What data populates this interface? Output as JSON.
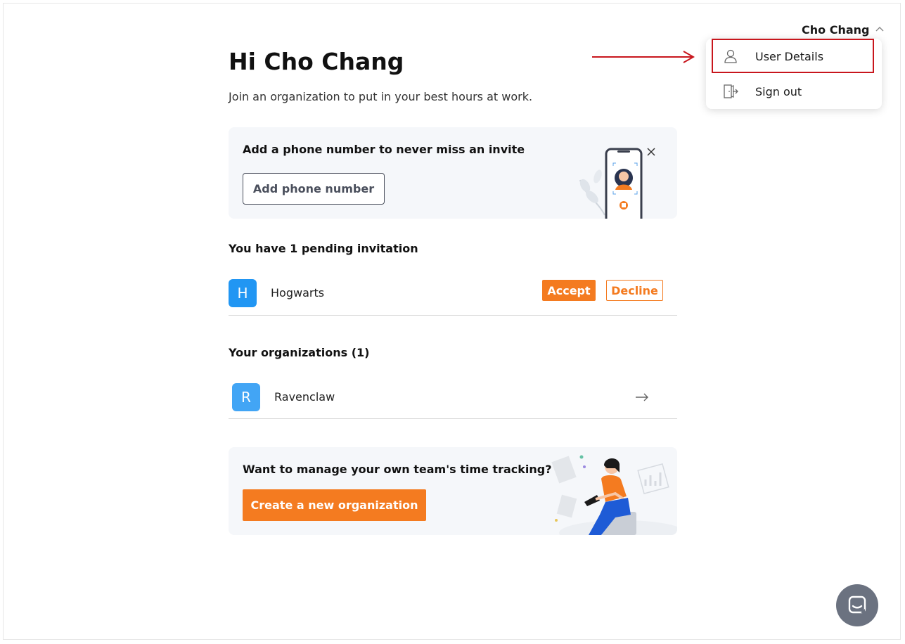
{
  "header": {
    "user_name": "Cho Chang",
    "menu": {
      "items": [
        {
          "label": "User Details",
          "icon": "user-icon"
        },
        {
          "label": "Sign out",
          "icon": "sign-out-icon"
        }
      ]
    }
  },
  "main": {
    "greeting": "Hi Cho Chang",
    "subtitle": "Join an organization to put in your best hours at work.",
    "phone_card": {
      "title": "Add a phone number to never miss an invite",
      "button_label": "Add phone number"
    },
    "invitations": {
      "title": "You have 1 pending invitation",
      "items": [
        {
          "initial": "H",
          "name": "Hogwarts",
          "accept_label": "Accept",
          "decline_label": "Decline"
        }
      ]
    },
    "organizations": {
      "title": "Your organizations (1)",
      "items": [
        {
          "initial": "R",
          "name": "Ravenclaw"
        }
      ]
    },
    "team_card": {
      "title": "Want to manage your own team's time tracking?",
      "button_label": "Create a new organization"
    }
  },
  "colors": {
    "accent": "#f47b20",
    "avatar_h": "#2196f3",
    "avatar_r": "#42a5f5",
    "annotation_red": "#c8161d",
    "chat_fab": "#6b7280"
  }
}
